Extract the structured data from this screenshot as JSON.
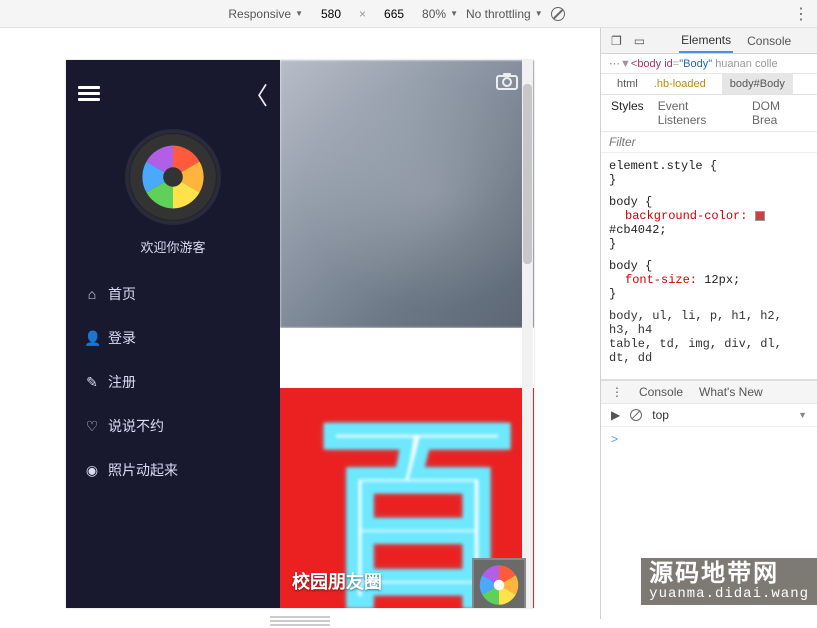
{
  "toolbar": {
    "responsive": "Responsive",
    "width": "580",
    "height": "665",
    "zoom": "80%",
    "throttling": "No throttling"
  },
  "sidebar": {
    "welcome": "欢迎你游客",
    "items": [
      {
        "label": "首页"
      },
      {
        "label": "登录"
      },
      {
        "label": "注册"
      },
      {
        "label": "说说不约"
      },
      {
        "label": "照片动起来"
      }
    ]
  },
  "hero": {
    "title": "校园朋友圈"
  },
  "devtools": {
    "tabs": {
      "elements": "Elements",
      "console": "Console"
    },
    "html_line": "<body id=\"Body\" huanan colle",
    "breadcrumb": {
      "a": "html",
      "cls": ".hb-loaded",
      "b": "body#Body"
    },
    "subtabs": {
      "styles": "Styles",
      "events": "Event Listeners",
      "dom": "DOM Brea"
    },
    "filter_placeholder": "Filter",
    "rules": {
      "element_style": "element.style {",
      "close": "}",
      "body1_sel": "body {",
      "body1_prop": "background-color:",
      "body1_val": "#cb4042;",
      "body2_sel": "body {",
      "body2_prop": "font-size:",
      "body2_val": "12px;",
      "many": "body, ul, li, p, h1, h2, h3, h4",
      "many2": "table, td, img, div, dl, dt, dd"
    },
    "console_tabs": {
      "console": "Console",
      "whatsnew": "What's New"
    },
    "top_label": "top",
    "prompt": ">"
  },
  "watermark": {
    "zh": "源码地带网",
    "en": "yuanma.didai.wang"
  }
}
